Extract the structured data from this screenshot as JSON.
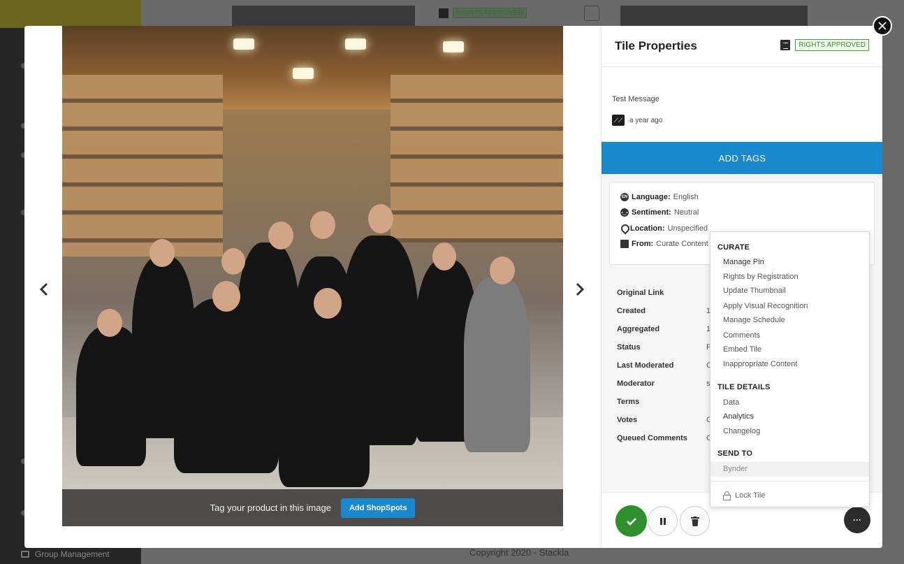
{
  "background": {
    "rights_badge": "RIGHTS APPROVED",
    "sidebar_item": "Group Management",
    "copyright": "Copyright 2020 - Stackla"
  },
  "media": {
    "tag_prompt": "Tag your product in this image",
    "shopspots_button": "Add ShopSpots"
  },
  "properties": {
    "title": "Tile Properties",
    "rights_badge": "RIGHTS APPROVED",
    "message": "Test Message",
    "timestamp": "a year ago",
    "add_tags": "ADD TAGS",
    "info": {
      "language_label": "Language:",
      "language_value": "English",
      "sentiment_label": "Sentiment:",
      "sentiment_value": "Neutral",
      "location_label": "Location:",
      "location_value": "Unspecified",
      "from_label": "From:",
      "from_value": "Curate Content"
    },
    "details": [
      {
        "label": "Original Link",
        "value": ""
      },
      {
        "label": "Created",
        "value": "1"
      },
      {
        "label": "Aggregated",
        "value": "1"
      },
      {
        "label": "Status",
        "value": "F"
      },
      {
        "label": "Last Moderated",
        "value": "C"
      },
      {
        "label": "Moderator",
        "value": "s"
      },
      {
        "label": "Terms",
        "value": ""
      },
      {
        "label": "Votes",
        "value": "C"
      },
      {
        "label": "Queued Comments",
        "value": "C"
      }
    ],
    "more_button": "···"
  },
  "menu": {
    "curate_header": "CURATE",
    "curate_items": [
      "Manage Pin",
      "Rights by Registration",
      "Update Thumbnail",
      "Apply Visual Recognition",
      "Manage Schedule",
      "Comments",
      "Embed Tile",
      "Inappropriate Content"
    ],
    "tile_details_header": "TILE DETAILS",
    "tile_details_items": [
      "Data",
      "Analytics",
      "Changelog"
    ],
    "send_to_header": "SEND TO",
    "send_to_items": [
      "Bynder"
    ],
    "lock_tile": "Lock Tile"
  },
  "colors": {
    "accent_blue": "#1a88cc",
    "approve_green": "#2f8f2c",
    "rights_green": "#4a9b38"
  }
}
